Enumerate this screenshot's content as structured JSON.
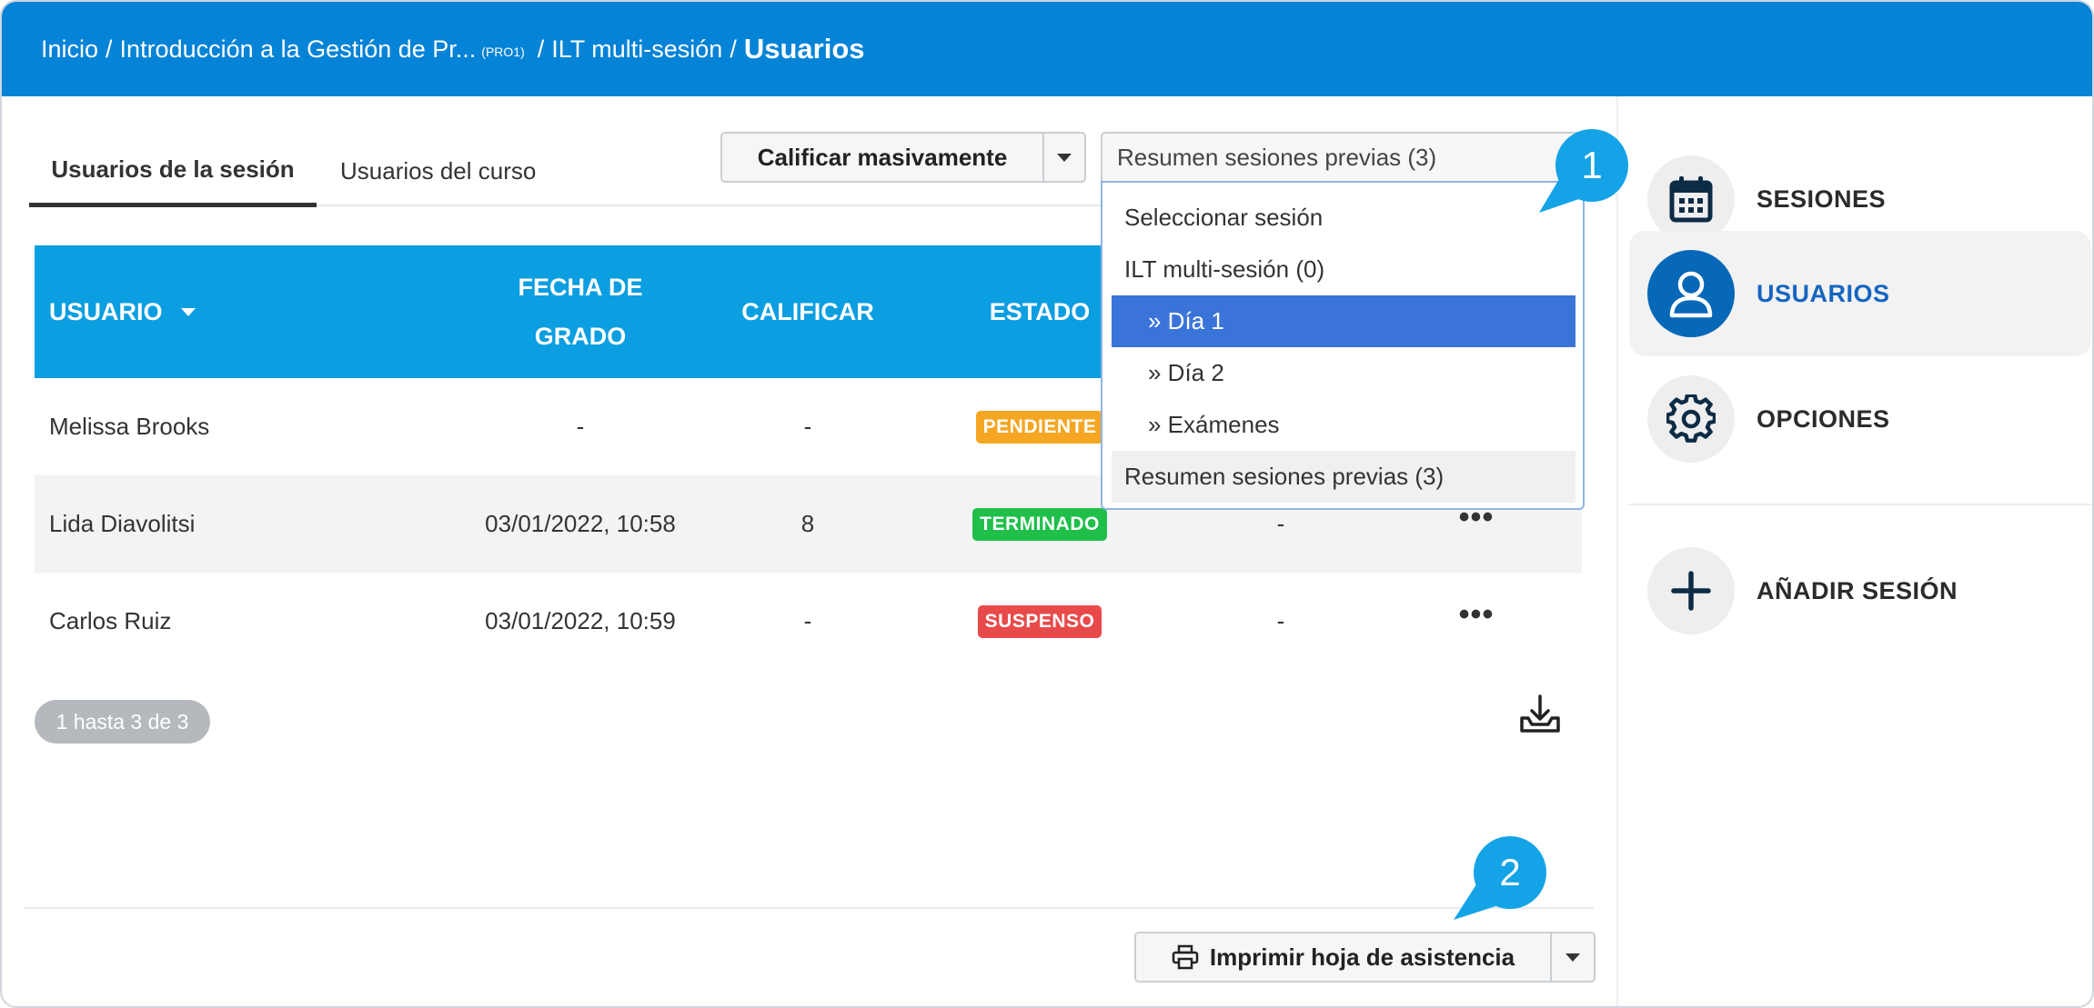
{
  "breadcrumb": {
    "home": "Inicio",
    "course": "Introducción a la Gestión de Pr...",
    "course_code": "(PRO1)",
    "activity": "ILT multi-sesión",
    "current": "Usuarios",
    "separator": "/"
  },
  "tabs": [
    {
      "label": "Usuarios de la sesión",
      "active": true
    },
    {
      "label": "Usuarios del curso",
      "active": false
    }
  ],
  "toolbar": {
    "bulk_grade_label": "Calificar masivamente",
    "session_select_value": "Resumen sesiones previas (3)"
  },
  "session_dropdown": {
    "options": [
      {
        "label": "Seleccionar sesión",
        "indent": false,
        "state": "normal"
      },
      {
        "label": "ILT multi-sesión (0)",
        "indent": false,
        "state": "normal"
      },
      {
        "label": "» Día 1",
        "indent": true,
        "state": "selected"
      },
      {
        "label": "» Día 2",
        "indent": true,
        "state": "normal"
      },
      {
        "label": "» Exámenes",
        "indent": true,
        "state": "normal"
      },
      {
        "label": "Resumen sesiones previas (3)",
        "indent": false,
        "state": "hover"
      }
    ]
  },
  "table": {
    "headers": {
      "user": "USUARIO",
      "date_line1": "FECHA DE",
      "date_line2": "GRADO",
      "grade": "CALIFICAR",
      "status": "ESTADO"
    },
    "rows": [
      {
        "user": "Melissa Brooks",
        "date": "-",
        "grade": "-",
        "status": "PENDIENTE",
        "status_color": "#f5a623",
        "extra": "",
        "more": ""
      },
      {
        "user": "Lida Diavolitsi",
        "date": "03/01/2022, 10:58",
        "grade": "8",
        "status": "TERMINADO",
        "status_color": "#1fbf4a",
        "extra": "-",
        "more": "•••"
      },
      {
        "user": "Carlos Ruiz",
        "date": "03/01/2022, 10:59",
        "grade": "-",
        "status": "SUSPENSO",
        "status_color": "#e84a4a",
        "extra": "-",
        "more": "•••"
      }
    ]
  },
  "pagination": {
    "label": "1 hasta 3 de 3"
  },
  "download_icon": "download-tray-icon",
  "print_button": {
    "label": "Imprimir hoja de asistencia",
    "icon": "printer-icon"
  },
  "callouts": [
    {
      "number": "1"
    },
    {
      "number": "2"
    }
  ],
  "sidebar": {
    "items": [
      {
        "label": "SESIONES",
        "icon": "calendar-icon",
        "active": false
      },
      {
        "label": "USUARIOS",
        "icon": "user-icon",
        "active": true
      },
      {
        "label": "OPCIONES",
        "icon": "gear-icon",
        "active": false
      },
      {
        "label": "AÑADIR SESIÓN",
        "icon": "plus-icon",
        "active": false
      }
    ]
  },
  "colors": {
    "topbar": "#0583d6",
    "table_header": "#0b9ee0",
    "accent_active": "#0868b8",
    "dropdown_selected": "#3b74d8",
    "callout": "#14a3e6"
  }
}
